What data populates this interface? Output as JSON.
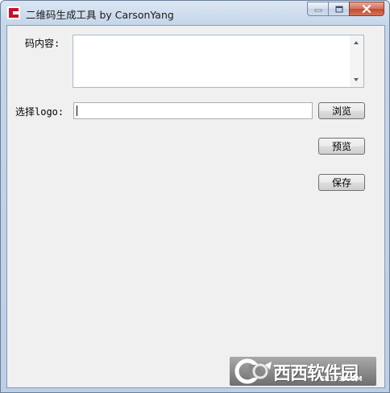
{
  "window": {
    "title": "二维码生成工具 by CarsonYang",
    "app_icon": "app-c-icon",
    "caption_buttons": [
      "minimize-icon",
      "maximize-icon",
      "close-icon"
    ]
  },
  "form": {
    "content_label": "码内容:",
    "content_value": "",
    "logo_label": "选择logo:",
    "logo_value": "",
    "browse_button": "浏览",
    "preview_button": "预览",
    "save_button": "保存"
  },
  "watermark": {
    "brand_text": "西西软件园",
    "url_text": "CR173.COM"
  },
  "colors": {
    "icon_red": "#c8102e",
    "title_bar": "#c5d6ea",
    "client_bg": "#f0f0f0",
    "close_red": "#c24a2f"
  }
}
